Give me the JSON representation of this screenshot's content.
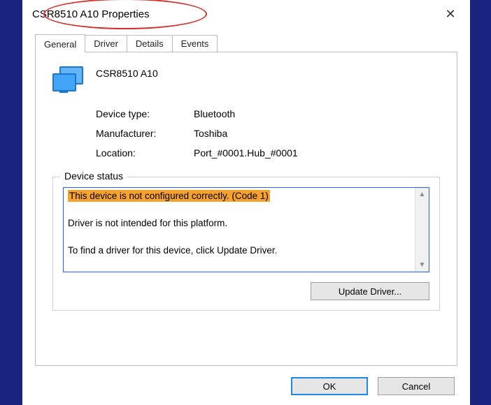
{
  "window": {
    "title": "CSR8510 A10 Properties"
  },
  "tabs": {
    "general": "General",
    "driver": "Driver",
    "details": "Details",
    "events": "Events"
  },
  "device": {
    "name": "CSR8510 A10",
    "type_label": "Device type:",
    "type_value": "Bluetooth",
    "mfr_label": "Manufacturer:",
    "mfr_value": "Toshiba",
    "loc_label": "Location:",
    "loc_value": "Port_#0001.Hub_#0001"
  },
  "status": {
    "legend": "Device status",
    "line1": "This device is not configured correctly. (Code 1)",
    "line2": "Driver is not intended for this platform.",
    "line3": "To find a driver for this device, click Update Driver.",
    "update_btn": "Update Driver..."
  },
  "buttons": {
    "ok": "OK",
    "cancel": "Cancel"
  }
}
